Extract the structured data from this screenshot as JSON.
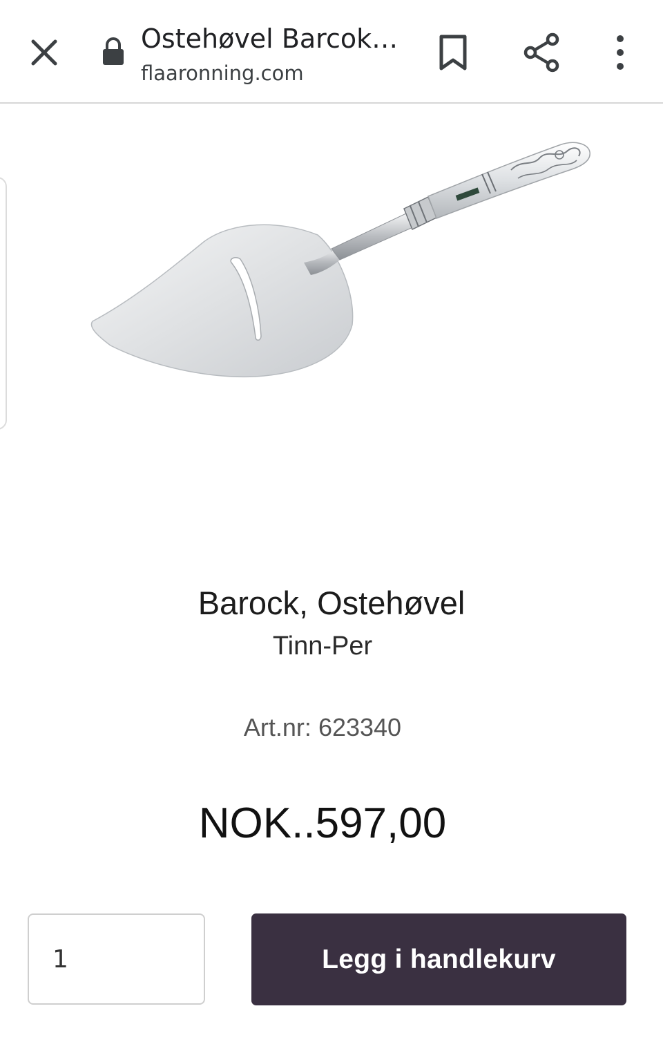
{
  "browser": {
    "page_title": "Ostehøvel Barcok…",
    "domain": "flaaronning.com",
    "icons": {
      "close": "close-icon",
      "lock": "lock-icon",
      "bookmark": "bookmark-icon",
      "share": "share-icon",
      "menu": "more-vert-icon"
    }
  },
  "product": {
    "name": "Barock, Ostehøvel",
    "brand": "Tinn-Per",
    "art_nr_label": "Art.nr:",
    "art_nr_value": "623340",
    "price": "NOK..597,00"
  },
  "cart": {
    "quantity": "1",
    "add_button_label": "Legg i handlekurv",
    "button_color": "#3a3041"
  }
}
